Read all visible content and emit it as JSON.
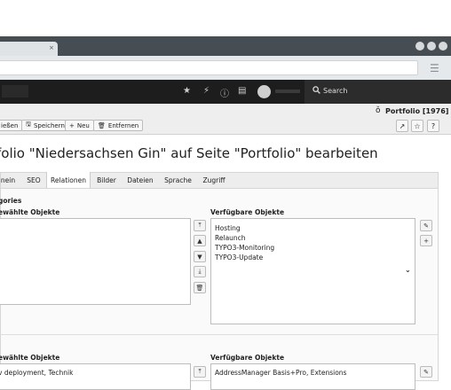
{
  "browser": {
    "tab_close": "×",
    "menu_icon": "☰"
  },
  "topbar": {
    "search_label": "Search"
  },
  "docheader": {
    "record_title": "Portfolio [1976]",
    "buttons": {
      "close": "ießen",
      "save": "Speichern",
      "new": "Neu",
      "delete": "Entfernen"
    }
  },
  "page": {
    "title": "folio \"Niedersachsen Gin\" auf Seite \"Portfolio\" bearbeiten"
  },
  "tabs": [
    "nein",
    "SEO",
    "Relationen",
    "Bilder",
    "Dateien",
    "Sprache",
    "Zugriff"
  ],
  "active_tab": "Relationen",
  "section1": {
    "heading": "gories",
    "selected_label": "ewählte Objekte",
    "available_label": "Verfügbare Objekte",
    "available_items": [
      "Hosting",
      "Relaunch",
      "TYPO3-Monitoring",
      "TYPO3-Update"
    ]
  },
  "section2": {
    "selected_label": "ewählte Objekte",
    "available_label": "Verfügbare Objekte",
    "selected_items": [
      "v deployment, Technik"
    ],
    "available_items": [
      "AddressManager Basis+Pro, Extensions"
    ]
  }
}
